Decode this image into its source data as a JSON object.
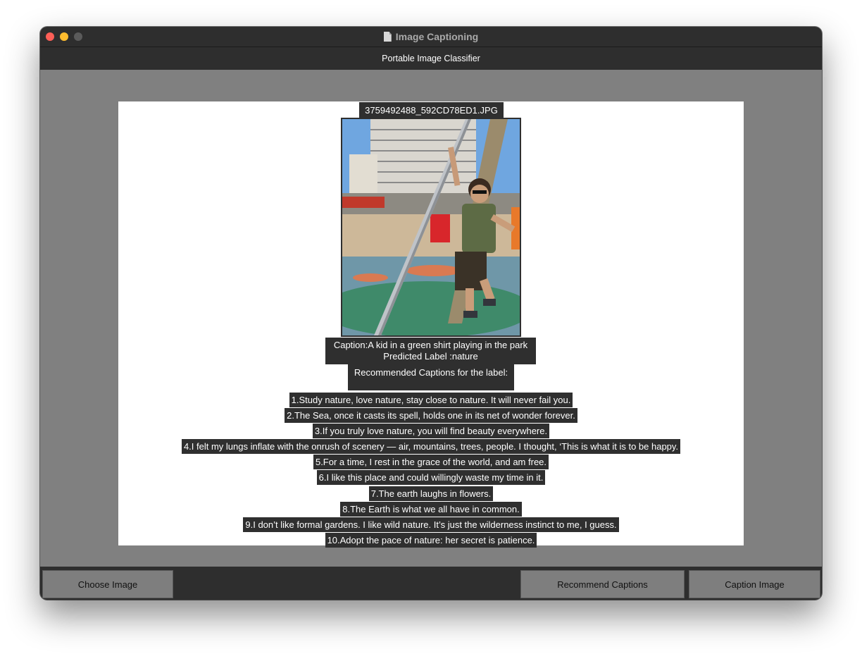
{
  "window": {
    "title": "Image Captioning",
    "header": "Portable Image Classifier"
  },
  "image": {
    "filename": "3759492488_592CD78ED1.JPG",
    "alt": "Photo of a kid in a green shirt hanging from a metal pole at a playground"
  },
  "result": {
    "caption": "Caption:A kid in a green shirt playing in the park",
    "predicted_label": "Predicted Label :nature",
    "recommended_heading": "Recommended Captions for the label:"
  },
  "recommendations": [
    "1.Study nature, love nature, stay close to nature. It will never fail you.",
    "2.The Sea, once it casts its spell, holds one in its net of wonder forever.",
    "3.If you truly love nature, you will find beauty everywhere.",
    "4.I felt my lungs inflate with the onrush of scenery — air, mountains, trees, people. I thought, ‘This is what it is to be happy.",
    "5.For a time, I rest in the grace of the world, and am free.",
    "6.I like this place and could willingly waste my time in it.",
    "7.The earth laughs in flowers.",
    "8.The Earth is what we all have in common.",
    "9.I don’t like formal gardens. I like wild nature. It’s just the wilderness instinct to me, I guess.",
    "10.Adopt the pace of nature: her secret is patience."
  ],
  "buttons": {
    "choose": "Choose Image",
    "recommend": "Recommend Captions",
    "caption": "Caption Image"
  },
  "colors": {
    "window_bg": "#808080",
    "bar_bg": "#2e2e2e",
    "label_bg": "#2f2f2f",
    "close": "#fe5f57",
    "minimize": "#febc2e"
  }
}
